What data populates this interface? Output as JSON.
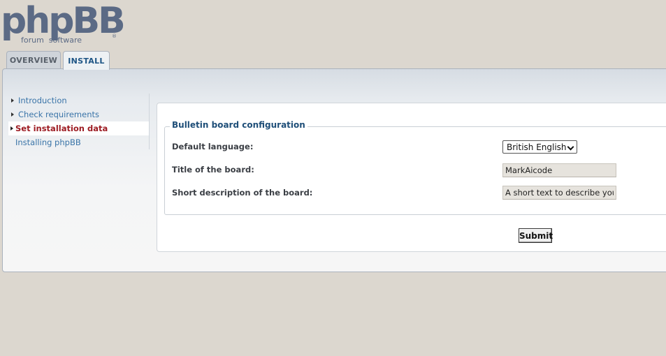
{
  "logo": {
    "main": "phpBB",
    "sub": "forum  software",
    "reg": "®"
  },
  "tabs": [
    {
      "label": "OVERVIEW"
    },
    {
      "label": "INSTALL"
    }
  ],
  "menu": {
    "items": [
      {
        "label": "Introduction"
      },
      {
        "label": "Check requirements"
      },
      {
        "label": "Set installation data"
      },
      {
        "label": "Installing phpBB"
      }
    ]
  },
  "form": {
    "legend": "Bulletin board configuration",
    "language_label": "Default language:",
    "language_value": "British English",
    "title_label": "Title of the board:",
    "title_value": "MarkAicode",
    "description_label": "Short description of the board:",
    "description_value": "A short text to describe your forum",
    "submit_label": "Submit"
  },
  "colors": {
    "accent": "#1e5585",
    "active_menu": "#9d1c23",
    "link": "#3a74a8",
    "background": "#dcd7cf"
  },
  "icons": {
    "menu_arrow": "triangle-right-icon",
    "select_chevron": "chevron-down-icon"
  }
}
